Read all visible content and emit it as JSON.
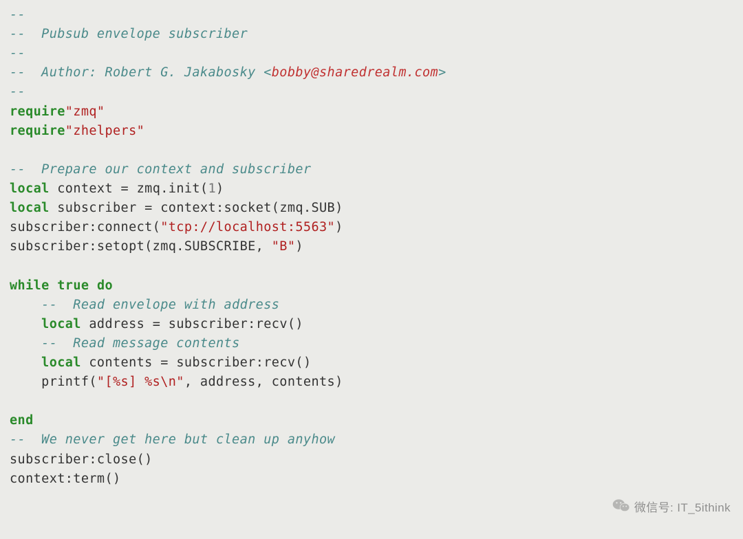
{
  "code": {
    "c1": "--",
    "c2": "--  Pubsub envelope subscriber",
    "c3": "--",
    "c4a": "--  Author: Robert G. Jakabosky <",
    "c4b": "bobby@sharedrealm.com",
    "c4c": ">",
    "c5": "--",
    "kw_require1": "require",
    "str_zmq": "\"zmq\"",
    "kw_require2": "require",
    "str_zhelpers": "\"zhelpers\"",
    "c6": "--  Prepare our context and subscriber",
    "kw_local1": "local",
    "id_context": " context ",
    "eq1": "=",
    "call_init_a": " zmq.init(",
    "num_1": "1",
    "call_init_b": ")",
    "kw_local2": "local",
    "id_subscriber": " subscriber ",
    "eq2": "=",
    "call_socket": " context:socket(zmq.SUB)",
    "call_connect_a": "subscriber:connect(",
    "str_tcp": "\"tcp://localhost:5563\"",
    "call_connect_b": ")",
    "call_setopt_a": "subscriber:setopt(zmq.SUBSCRIBE, ",
    "str_B": "\"B\"",
    "call_setopt_b": ")",
    "kw_while": "while",
    "kw_true": " true ",
    "kw_do": "do",
    "c7": "--  Read envelope with address",
    "kw_local3": "local",
    "id_address": " address ",
    "eq3": "=",
    "call_recv1": " subscriber:recv()",
    "c8": "--  Read message contents",
    "kw_local4": "local",
    "id_contents": " contents ",
    "eq4": "=",
    "call_recv2": " subscriber:recv()",
    "call_printf_a": "printf(",
    "str_fmt": "\"[%s] %s\\n\"",
    "call_printf_b": ", address, contents)",
    "kw_end": "end",
    "c9": "--  We never get here but clean up anyhow",
    "call_close": "subscriber:close()",
    "call_term": "context:term()"
  },
  "watermark": {
    "label": "微信号: IT_5ithink"
  }
}
